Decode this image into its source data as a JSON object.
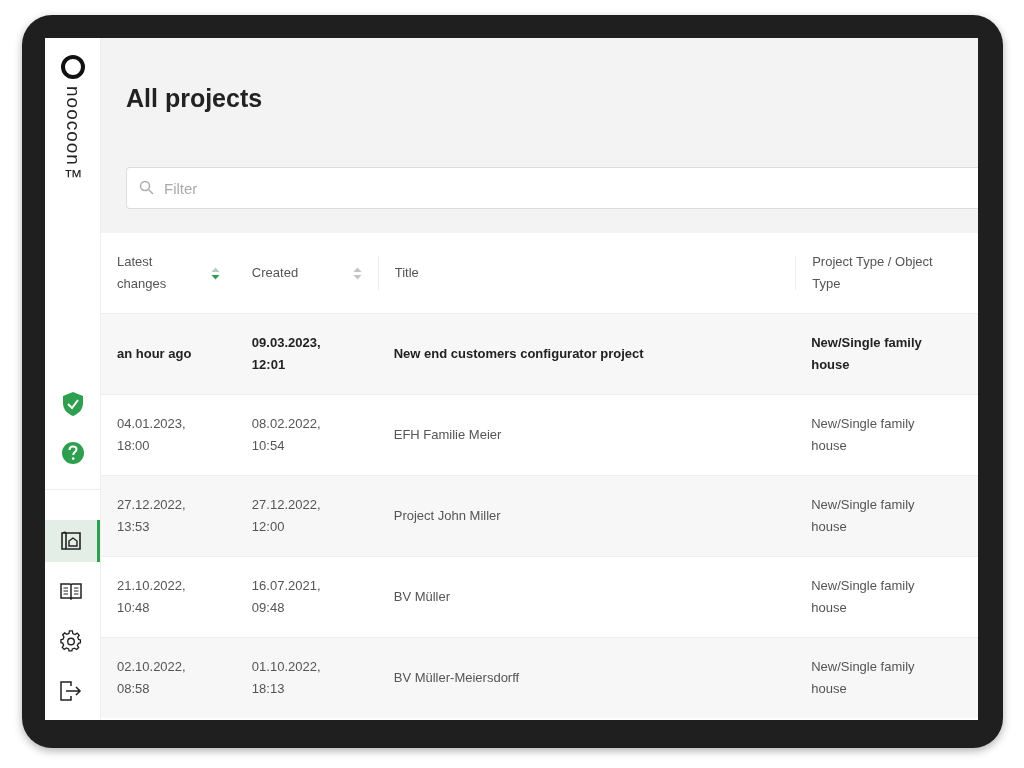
{
  "brand": {
    "name": "noocoon™"
  },
  "sidebar": {
    "status_items": [
      {
        "kind": "shield"
      },
      {
        "kind": "help"
      }
    ],
    "nav_items": [
      {
        "kind": "projects",
        "selected": true
      },
      {
        "kind": "catalog",
        "selected": false
      },
      {
        "kind": "settings",
        "selected": false
      },
      {
        "kind": "logout",
        "selected": false
      }
    ]
  },
  "page": {
    "title": "All projects"
  },
  "filter": {
    "placeholder": "Filter"
  },
  "table": {
    "columns": [
      {
        "label": "Latest changes",
        "kind": "sorted"
      },
      {
        "label": "Created",
        "kind": "sortable"
      },
      {
        "label": "Title",
        "kind": "plain"
      },
      {
        "label": "Project Type / Object Type",
        "kind": "plain"
      }
    ],
    "rows": [
      {
        "unread": true,
        "cells": [
          "an hour ago",
          "09.03.2023, 12:01",
          "New end customers configurator project",
          "New/Single family house"
        ]
      },
      {
        "unread": false,
        "cells": [
          "04.01.2023, 18:00",
          "08.02.2022, 10:54",
          "EFH Familie Meier",
          "New/Single family house"
        ]
      },
      {
        "unread": false,
        "cells": [
          "27.12.2022, 13:53",
          "27.12.2022, 12:00",
          "Project John Miller",
          "New/Single family house"
        ]
      },
      {
        "unread": false,
        "cells": [
          "21.10.2022, 10:48",
          "16.07.2021, 09:48",
          "BV Müller",
          "New/Single family house"
        ]
      },
      {
        "unread": false,
        "cells": [
          "02.10.2022, 08:58",
          "01.10.2022, 18:13",
          "BV Müller-Meiersdorff",
          "New/Single family house"
        ]
      }
    ]
  }
}
